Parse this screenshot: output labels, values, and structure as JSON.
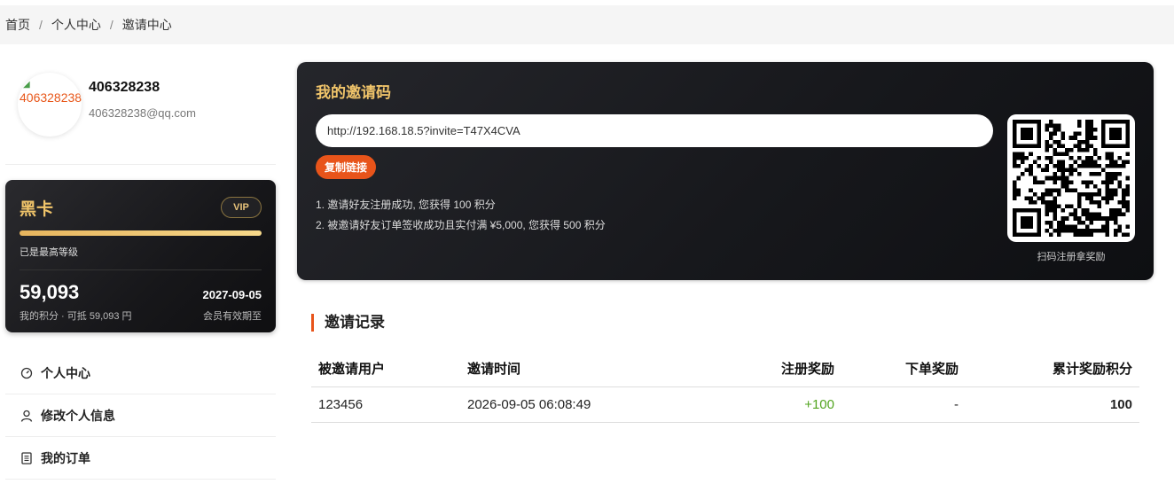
{
  "breadcrumb": {
    "home": "首页",
    "center": "个人中心",
    "current": "邀请中心",
    "separator": "/"
  },
  "profile": {
    "avatar_alt": "406328238",
    "name": "406328238",
    "email": "406328238@qq.com"
  },
  "vip_card": {
    "level": "黑卡",
    "badge": "VIP",
    "progress_percent": 100,
    "level_text": "已是最高等级",
    "points": "59,093",
    "points_sub": "我的积分 · 可抵 59,093 円",
    "expire_date": "2027-09-05",
    "expire_label": "会员有效期至"
  },
  "menu": {
    "items": [
      {
        "label": "个人中心",
        "icon": "dashboard-icon"
      },
      {
        "label": "修改个人信息",
        "icon": "user-icon"
      },
      {
        "label": "我的订单",
        "icon": "document-icon"
      }
    ]
  },
  "invite": {
    "title": "我的邀请码",
    "link": "http://192.168.18.5?invite=T47X4CVA",
    "copy_label": "复制链接",
    "rule1": "1. 邀请好友注册成功, 您获得 100 积分",
    "rule2": "2. 被邀请好友订单签收成功且实付满 ¥5,000, 您获得 500 积分",
    "qr_caption": "扫码注册拿奖励"
  },
  "records": {
    "title": "邀请记录",
    "headers": [
      "被邀请用户",
      "邀请时间",
      "注册奖励",
      "下单奖励",
      "累计奖励积分"
    ],
    "rows": [
      {
        "user": "123456",
        "time": "2026-09-05 06:08:49",
        "reg_reward": "+100",
        "order_reward": "-",
        "total": "100"
      }
    ]
  },
  "colors": {
    "accent": "#e8541a",
    "gold": "#f0c46a",
    "green": "#52a41f",
    "card_dark": "#17181c"
  }
}
